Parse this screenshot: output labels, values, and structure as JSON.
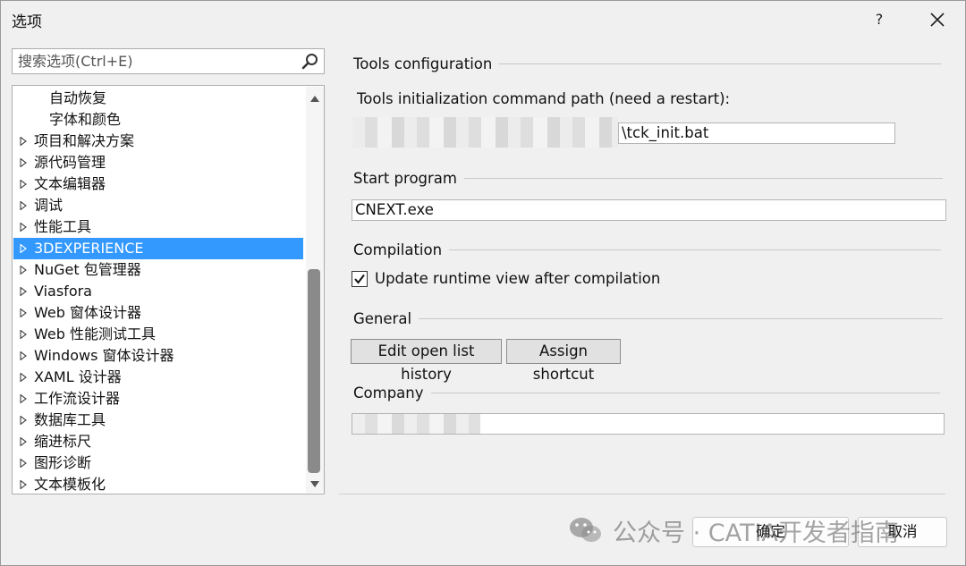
{
  "window": {
    "title": "选项",
    "help_label": "?"
  },
  "search": {
    "placeholder": "搜索选项(Ctrl+E)"
  },
  "tree": {
    "items": [
      {
        "label": "自动恢复",
        "expandable": false,
        "child": true
      },
      {
        "label": "字体和颜色",
        "expandable": false,
        "child": true
      },
      {
        "label": "项目和解决方案",
        "expandable": true
      },
      {
        "label": "源代码管理",
        "expandable": true
      },
      {
        "label": "文本编辑器",
        "expandable": true
      },
      {
        "label": "调试",
        "expandable": true
      },
      {
        "label": "性能工具",
        "expandable": true
      },
      {
        "label": "3DEXPERIENCE",
        "expandable": true,
        "selected": true
      },
      {
        "label": "NuGet 包管理器",
        "expandable": true
      },
      {
        "label": "Viasfora",
        "expandable": true
      },
      {
        "label": "Web 窗体设计器",
        "expandable": true
      },
      {
        "label": "Web 性能测试工具",
        "expandable": true
      },
      {
        "label": "Windows 窗体设计器",
        "expandable": true
      },
      {
        "label": "XAML 设计器",
        "expandable": true
      },
      {
        "label": "工作流设计器",
        "expandable": true
      },
      {
        "label": "数据库工具",
        "expandable": true
      },
      {
        "label": "缩进标尺",
        "expandable": true
      },
      {
        "label": "图形诊断",
        "expandable": true
      },
      {
        "label": "文本模板化",
        "expandable": true
      }
    ]
  },
  "settings": {
    "tools_config_header": "Tools configuration",
    "tools_init_label": "Tools initialization command path (need a restart):",
    "tools_init_value": "\\tck_init.bat",
    "start_program_header": "Start program",
    "start_program_value": "CNEXT.exe",
    "compilation_header": "Compilation",
    "update_runtime_label": "Update runtime view after compilation",
    "update_runtime_checked": true,
    "general_header": "General",
    "edit_history_label": "Edit open list history",
    "assign_shortcut_label": "Assign shortcut",
    "company_header": "Company",
    "company_value": ""
  },
  "footer": {
    "ok_label": "确定",
    "cancel_label": "取消"
  },
  "watermark": {
    "text": "公众号 · CATIA开发者指南"
  },
  "colors": {
    "selection": "#3399ff",
    "background": "#f0f0f0"
  }
}
